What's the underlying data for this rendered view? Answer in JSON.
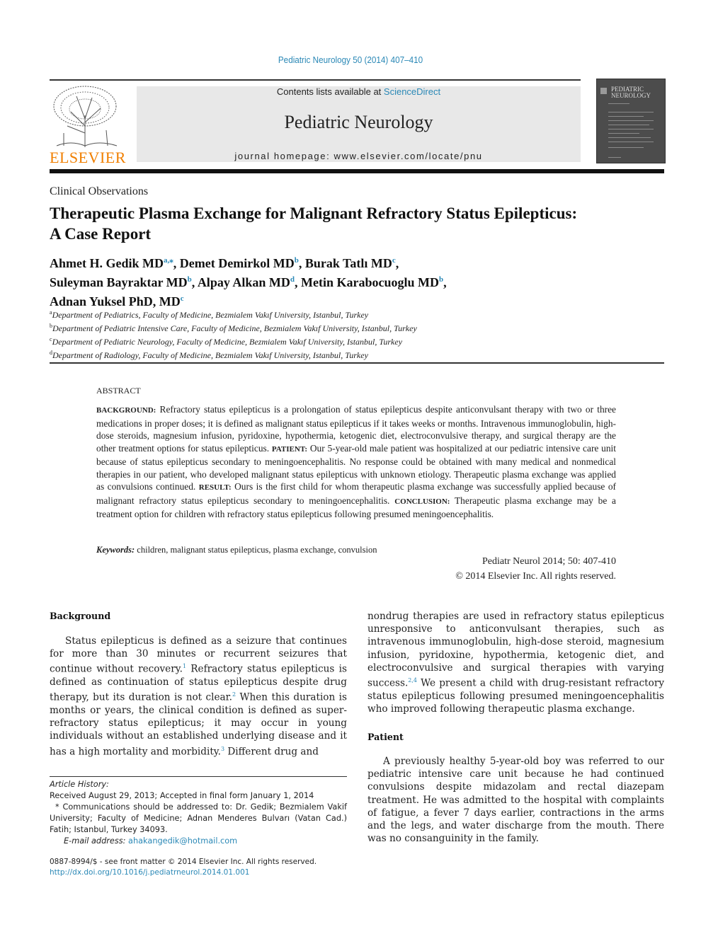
{
  "header": {
    "journal_ref": "Pediatric Neurology 50 (2014) 407–410",
    "contents_prefix": "Contents lists available at ",
    "contents_link": "ScienceDirect",
    "journal_name": "Pediatric Neurology",
    "homepage": "journal homepage: www.elsevier.com/locate/pnu",
    "publisher_logo": "ELSEVIER",
    "cover_title_line1": "PEDIATRIC",
    "cover_title_line2": "NEUROLOGY"
  },
  "article": {
    "section": "Clinical Observations",
    "title": "Therapeutic Plasma Exchange for Malignant Refractory Status Epilepticus: A Case Report",
    "authors": [
      {
        "name": "Ahmet H. Gedik MD",
        "aff": "a,⁎"
      },
      {
        "name": "Demet Demirkol MD",
        "aff": "b"
      },
      {
        "name": "Burak Tatlı MD",
        "aff": "c"
      },
      {
        "name": "Suleyman Bayraktar MD",
        "aff": "b"
      },
      {
        "name": "Alpay Alkan MD",
        "aff": "d"
      },
      {
        "name": "Metin Karabocuoglu MD",
        "aff": "b"
      },
      {
        "name": "Adnan Yuksel PhD, MD",
        "aff": "c"
      }
    ],
    "affiliations": [
      {
        "key": "a",
        "text": "Department of Pediatrics, Faculty of Medicine, Bezmialem Vakıf University, Istanbul, Turkey"
      },
      {
        "key": "b",
        "text": "Department of Pediatric Intensive Care, Faculty of Medicine, Bezmialem Vakıf University, Istanbul, Turkey"
      },
      {
        "key": "c",
        "text": "Department of Pediatric Neurology, Faculty of Medicine, Bezmialem Vakıf University, Istanbul, Turkey"
      },
      {
        "key": "d",
        "text": "Department of Radiology, Faculty of Medicine, Bezmialem Vakıf University, Istanbul, Turkey"
      }
    ]
  },
  "abstract": {
    "heading": "ABSTRACT",
    "background_label": "BACKGROUND:",
    "background": "Refractory status epilepticus is a prolongation of status epilepticus despite anticonvulsant therapy with two or three medications in proper doses; it is defined as malignant status epilepticus if it takes weeks or months. Intravenous immunoglobulin, high-dose steroids, magnesium infusion, pyridoxine, hypothermia, ketogenic diet, electroconvulsive therapy, and surgical therapy are the other treatment options for status epilepticus.",
    "patient_label": "PATIENT:",
    "patient": "Our 5-year-old male patient was hospitalized at our pediatric intensive care unit because of status epilepticus secondary to meningoencephalitis. No response could be obtained with many medical and nonmedical therapies in our patient, who developed malignant status epilepticus with unknown etiology. Therapeutic plasma exchange was applied as convulsions continued.",
    "result_label": "RESULT:",
    "result": "Ours is the first child for whom therapeutic plasma exchange was successfully applied because of malignant refractory status epilepticus secondary to meningoencephalitis.",
    "conclusion_label": "CONCLUSION:",
    "conclusion": "Therapeutic plasma exchange may be a treatment option for children with refractory status epilepticus following presumed meningoencephalitis.",
    "keywords_label": "Keywords:",
    "keywords": "children, malignant status epilepticus, plasma exchange, convulsion",
    "citation": "Pediatr Neurol 2014; 50: 407-410",
    "copyright": "© 2014 Elsevier Inc. All rights reserved."
  },
  "body": {
    "background_heading": "Background",
    "bg_p1": "Status epilepticus is defined as a seizure that continues for more than 30 minutes or recurrent seizures that continue without recovery.",
    "bg_ref1": "1",
    "bg_p2": " Refractory status epilepticus is defined as continuation of status epilepticus despite drug therapy, but its duration is not clear.",
    "bg_ref2": "2",
    "bg_p3": " When this duration is months or years, the clinical condition is defined as super-refractory status epilepticus; it may occur in young individuals without an established underlying disease and it has a high mortality and morbidity.",
    "bg_ref3": "3",
    "bg_p4": " Different drug and",
    "right_p1": "nondrug therapies are used in refractory status epilepticus unresponsive to anticonvulsant therapies, such as intravenous immunoglobulin, high-dose steroid, magnesium infusion, pyridoxine, hypothermia, ketogenic diet, and electroconvulsive and surgical therapies with varying success.",
    "right_ref": "2,4",
    "right_p2": " We present a child with drug-resistant refractory status epilepticus following presumed meningoencephalitis who improved following therapeutic plasma exchange.",
    "patient_heading": "Patient",
    "patient_text": "A previously healthy 5-year-old boy was referred to our pediatric intensive care unit because he had continued convulsions despite midazolam and rectal diazepam treatment. He was admitted to the hospital with complaints of fatigue, a fever 7 days earlier, contractions in the arms and the legs, and water discharge from the mouth. There was no consanguinity in the family."
  },
  "footnotes": {
    "history_label": "Article History:",
    "history": "Received August 29, 2013; Accepted in final form January 1, 2014",
    "correspondence": "* Communications should be addressed to: Dr. Gedik; Bezmialem Vakif University; Faculty of Medicine; Adnan Menderes Bulvarı (Vatan Cad.) Fatih; Istanbul, Turkey 34093.",
    "email_label": "E-mail address: ",
    "email": "ahakangedik@hotmail.com",
    "issn": "0887-8994/$ - see front matter © 2014 Elsevier Inc. All rights reserved.",
    "doi": "http://dx.doi.org/10.1016/j.pediatrneurol.2014.01.001"
  }
}
